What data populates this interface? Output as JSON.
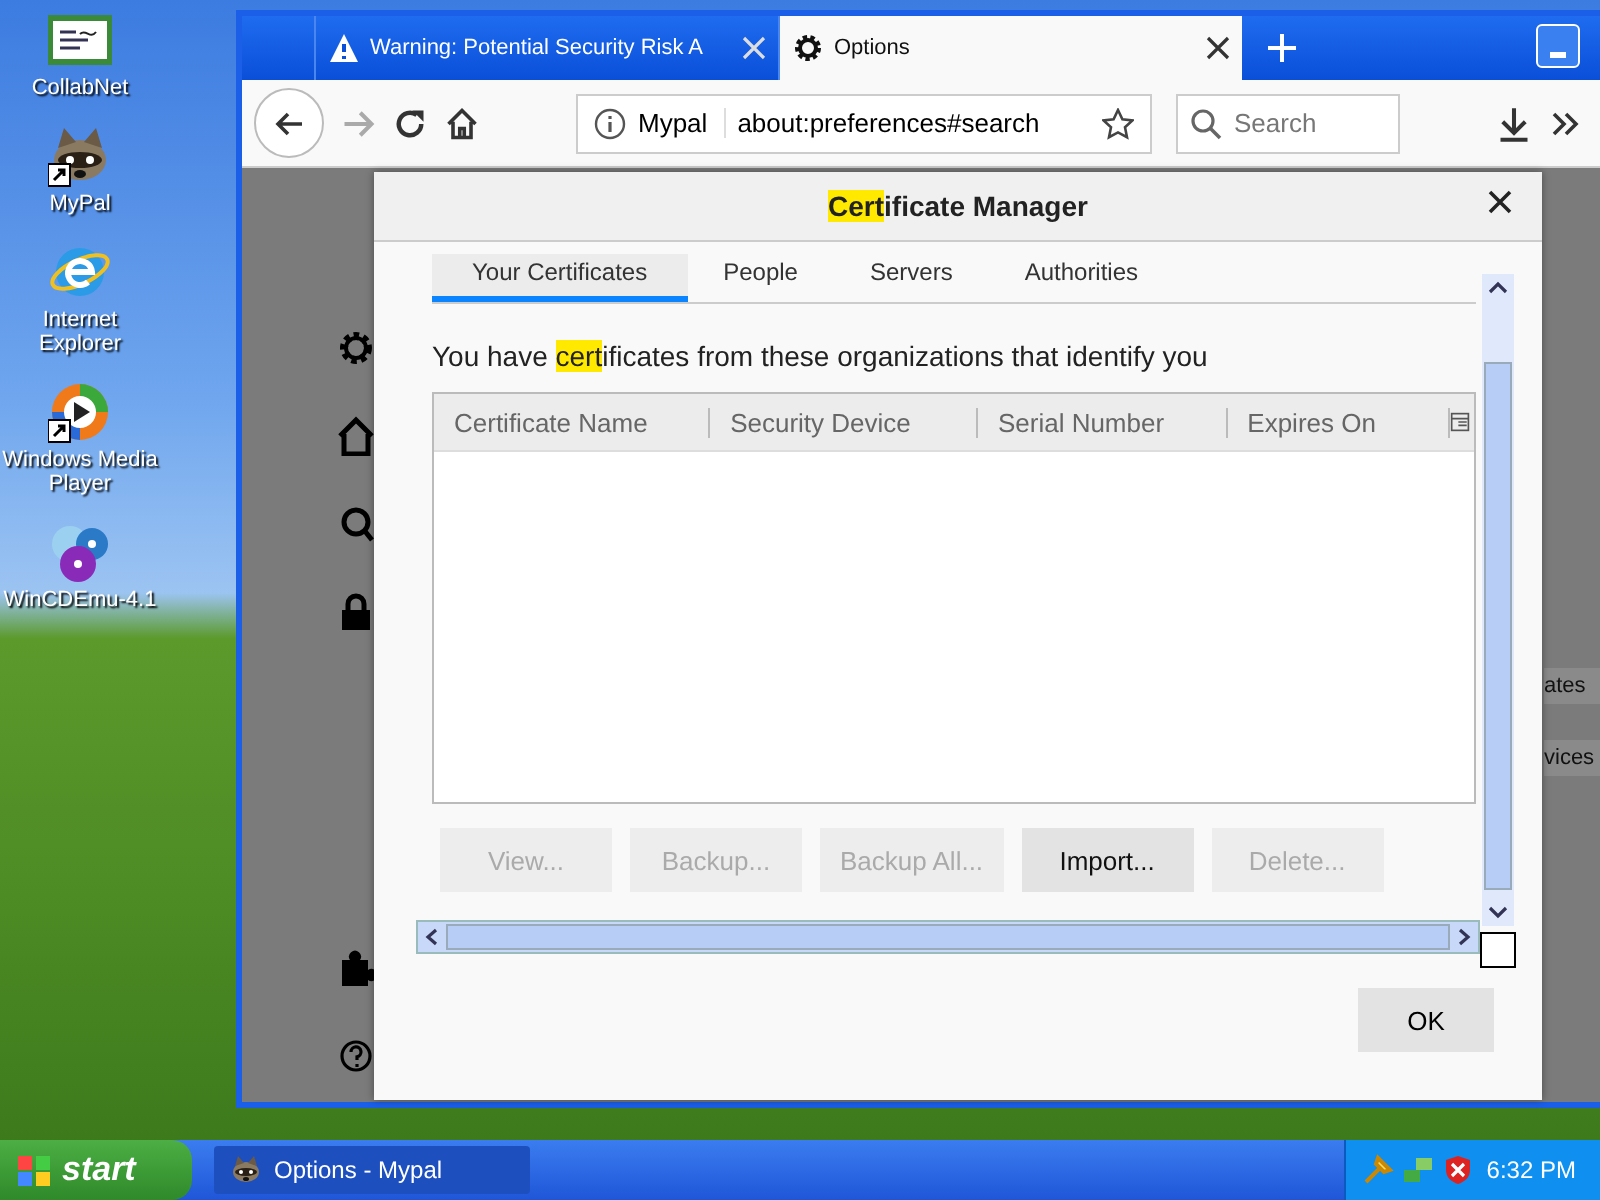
{
  "desktop": {
    "icons": [
      {
        "label": "CollabNet",
        "kind": "certificate",
        "shortcut": false
      },
      {
        "label": "MyPal",
        "kind": "raccoon",
        "shortcut": true
      },
      {
        "label": "Internet Explorer",
        "kind": "globe",
        "shortcut": false
      },
      {
        "label": "Windows Media Player",
        "kind": "media",
        "shortcut": true
      },
      {
        "label": "WinCDEmu-4.1",
        "kind": "discs",
        "shortcut": false
      }
    ]
  },
  "browser": {
    "tabs": [
      {
        "title": "Warning: Potential Security Risk A",
        "kind": "warning",
        "selected": false
      },
      {
        "title": "Options",
        "kind": "gear",
        "selected": true
      }
    ],
    "url": {
      "site": "Mypal",
      "address": "about:preferences#search"
    },
    "search": {
      "placeholder": "Search"
    },
    "page": {
      "buttons_behind": [
        "ates",
        "vices"
      ]
    }
  },
  "dialog": {
    "title_parts": [
      {
        "text": "Cert",
        "highlighted": true
      },
      {
        "text": "ificate Manager",
        "highlighted": false
      }
    ],
    "tabs": [
      {
        "label": "Your Certificates",
        "selected": true
      },
      {
        "label": "People",
        "selected": false
      },
      {
        "label": "Servers",
        "selected": false
      },
      {
        "label": "Authorities",
        "selected": false
      }
    ],
    "description_parts": [
      {
        "text": "You have ",
        "highlighted": false
      },
      {
        "text": "cert",
        "highlighted": true
      },
      {
        "text": "ificates from these organizations that identify you",
        "highlighted": false
      }
    ],
    "columns": [
      "Certificate Name",
      "Security Device",
      "Serial Number",
      "Expires On"
    ],
    "buttons": [
      {
        "label": "View...",
        "disabled": true
      },
      {
        "label": "Backup...",
        "disabled": true
      },
      {
        "label": "Backup All...",
        "disabled": true
      },
      {
        "label": "Import...",
        "disabled": false
      },
      {
        "label": "Delete...",
        "disabled": true
      }
    ],
    "ok": "OK"
  },
  "taskbar": {
    "start": "start",
    "tasks": [
      {
        "label": "Options - Mypal",
        "selected": true
      }
    ],
    "clock": "6:32 PM"
  }
}
